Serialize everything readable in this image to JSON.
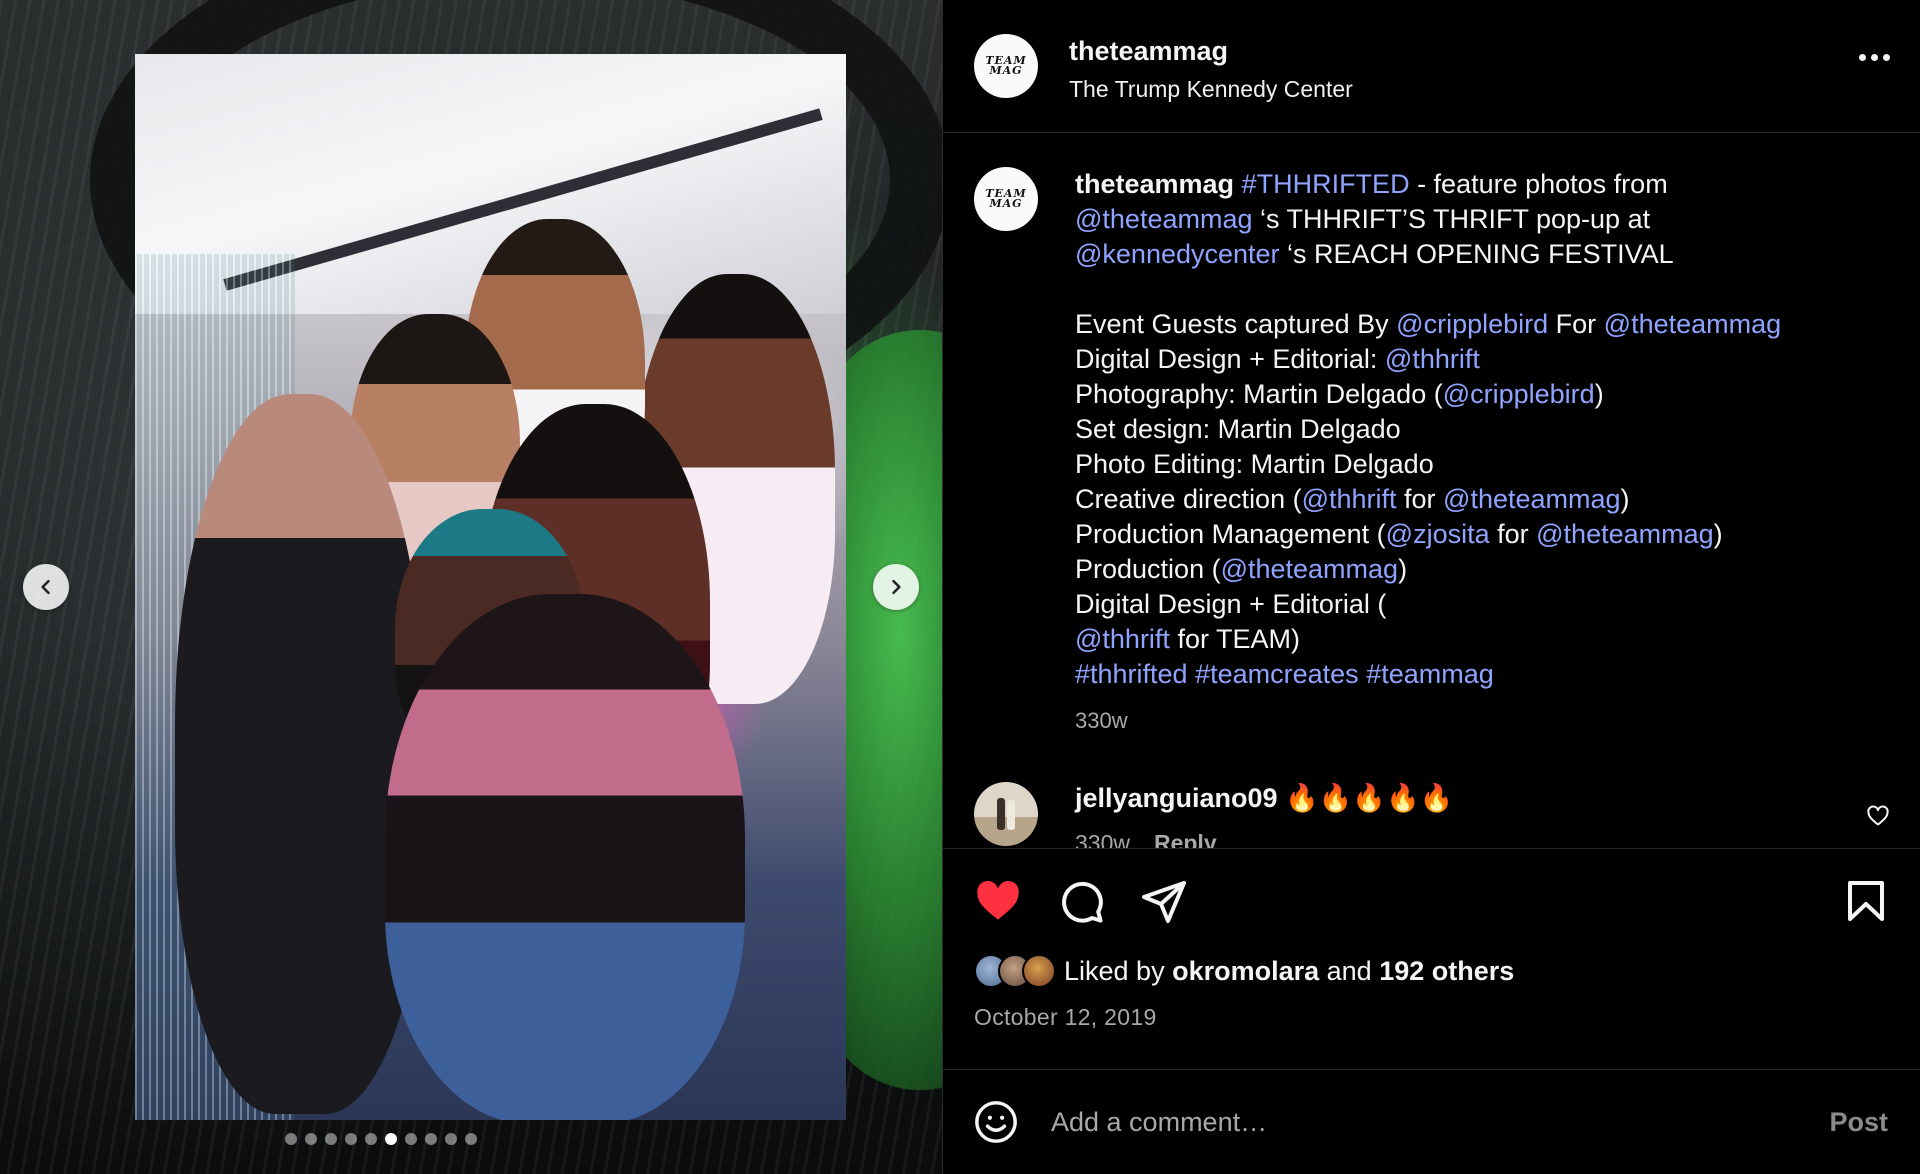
{
  "post": {
    "account": {
      "username": "theteammag",
      "location": "The Trump Kennedy Center",
      "avatar_text": "TEAM\nMAG"
    },
    "caption": {
      "lines": [
        [
          {
            "t": "theteammag",
            "k": "user"
          },
          {
            "t": " "
          },
          {
            "t": "#THHRIFTED",
            "k": "link"
          },
          {
            "t": " - feature photos from"
          }
        ],
        [
          {
            "t": "@theteammag",
            "k": "link"
          },
          {
            "t": " ‘s THHRIFT’S THRIFT pop-up at"
          }
        ],
        [
          {
            "t": "@kennedycenter",
            "k": "link"
          },
          {
            "t": " ‘s REACH OPENING FESTIVAL"
          }
        ],
        [],
        [
          {
            "t": "Event Guests captured By "
          },
          {
            "t": "@cripplebird",
            "k": "link"
          },
          {
            "t": " For "
          },
          {
            "t": "@theteammag",
            "k": "link"
          }
        ],
        [
          {
            "t": "Digital Design + Editorial: "
          },
          {
            "t": "@thhrift",
            "k": "link"
          }
        ],
        [
          {
            "t": "Photography: Martin Delgado ("
          },
          {
            "t": "@cripplebird",
            "k": "link"
          },
          {
            "t": ")"
          }
        ],
        [
          {
            "t": "Set design: Martin Delgado"
          }
        ],
        [
          {
            "t": "Photo Editing: Martin Delgado"
          }
        ],
        [
          {
            "t": "Creative direction ("
          },
          {
            "t": "@thhrift",
            "k": "link"
          },
          {
            "t": " for "
          },
          {
            "t": "@theteammag",
            "k": "link"
          },
          {
            "t": ")"
          }
        ],
        [
          {
            "t": "Production Management ("
          },
          {
            "t": "@zjosita",
            "k": "link"
          },
          {
            "t": " for "
          },
          {
            "t": "@theteammag",
            "k": "link"
          },
          {
            "t": ")"
          }
        ],
        [
          {
            "t": "Production ("
          },
          {
            "t": "@theteammag",
            "k": "link"
          },
          {
            "t": ")"
          }
        ],
        [
          {
            "t": "Digital Design + Editorial ("
          }
        ],
        [
          {
            "t": "@thhrift",
            "k": "link"
          },
          {
            "t": " for TEAM)"
          }
        ],
        [
          {
            "t": "#thhrifted",
            "k": "link"
          },
          {
            "t": " "
          },
          {
            "t": "#teamcreates",
            "k": "link"
          },
          {
            "t": " "
          },
          {
            "t": "#teammag",
            "k": "link"
          }
        ]
      ],
      "time": "330w"
    },
    "comments": [
      {
        "username": "jellyanguiano09",
        "text": "🔥🔥🔥🔥🔥",
        "time": "330w",
        "reply_label": "Reply"
      }
    ],
    "likes": {
      "prefix": "Liked by ",
      "user": "okromolara",
      "middle": " and ",
      "others": "192 others"
    },
    "date": "October 12, 2019",
    "comment_input": {
      "placeholder": "Add a comment…",
      "post_label": "Post"
    }
  },
  "carousel": {
    "total": 10,
    "active_index": 5
  },
  "icons": {
    "prev": "chevron-left-icon",
    "next": "chevron-right-icon",
    "more": "more-horizontal-icon",
    "like": "heart-filled-icon",
    "comment": "comment-bubble-icon",
    "share": "paper-plane-icon",
    "save": "bookmark-icon",
    "emoji": "emoji-smile-icon"
  },
  "colors": {
    "like_red": "#ff3040",
    "link_blue": "#8fa3ff",
    "background": "#000000"
  }
}
